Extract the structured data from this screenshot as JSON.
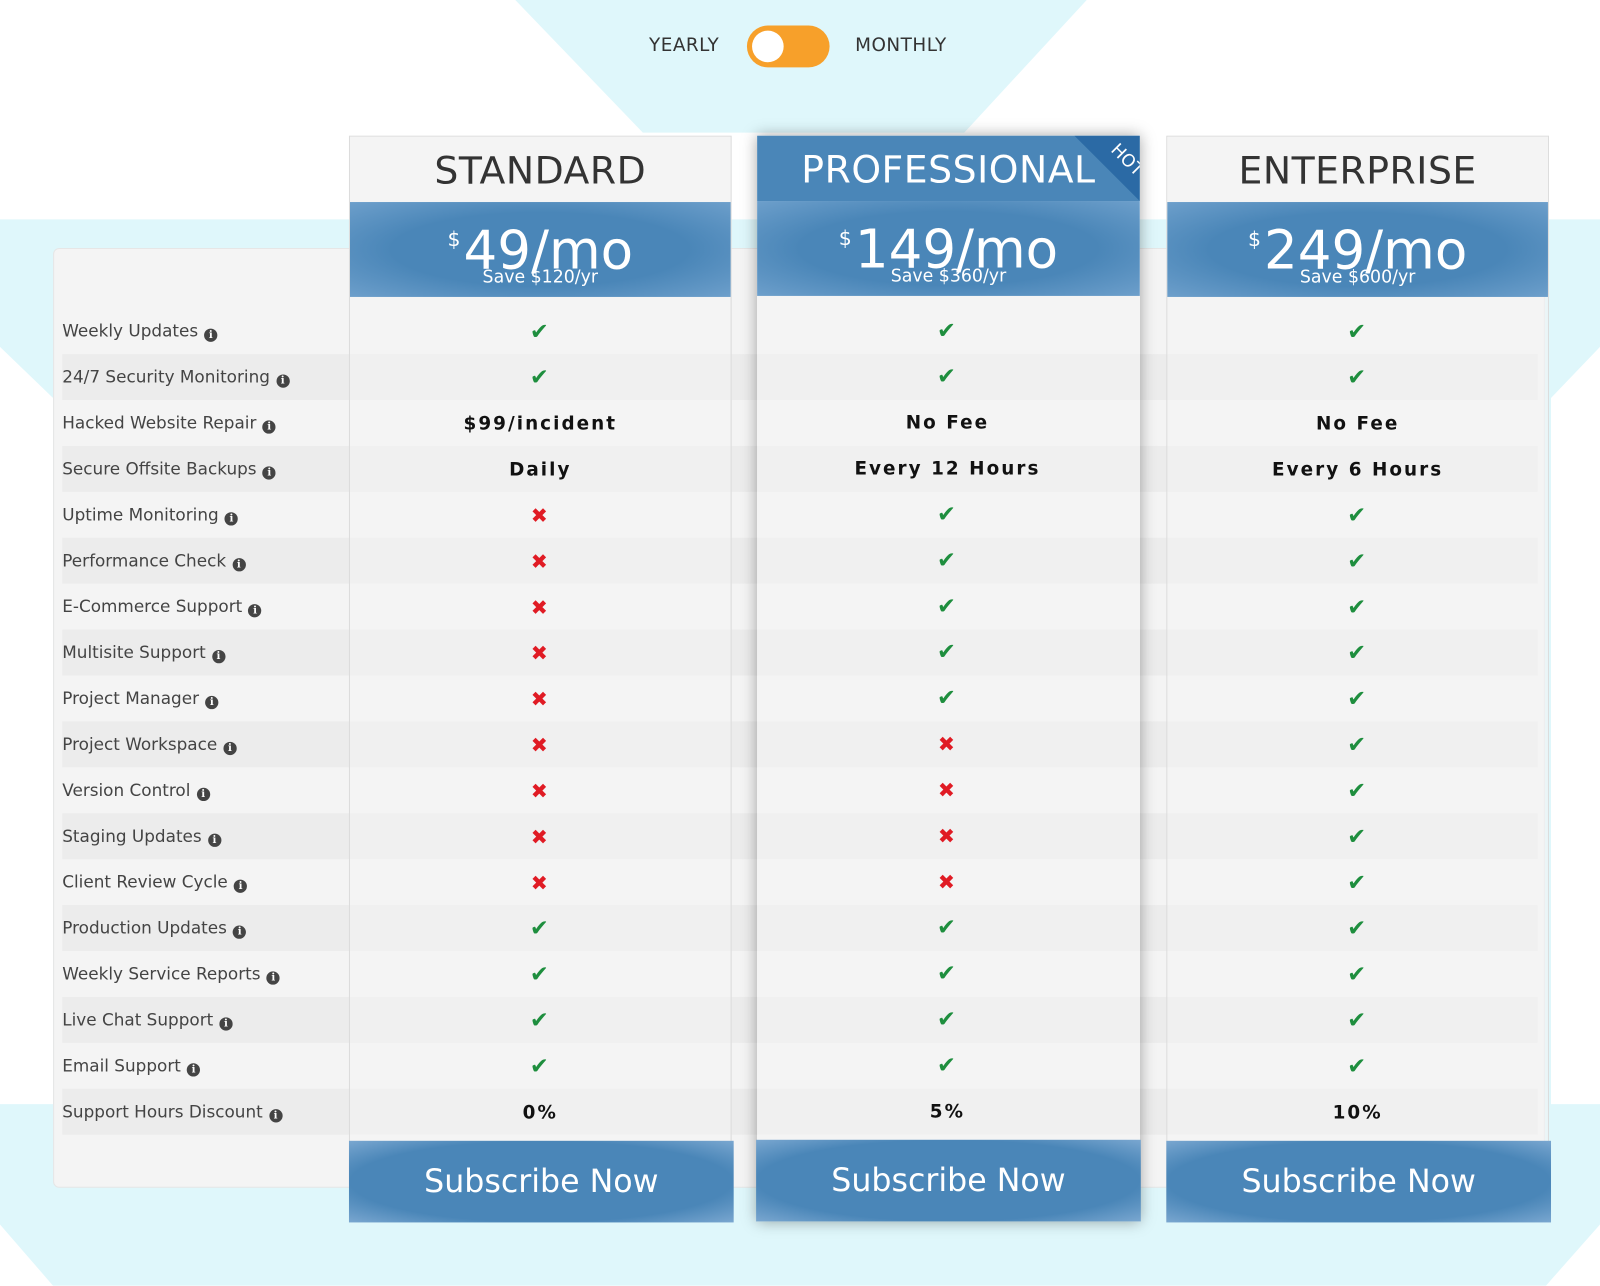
{
  "colors": {
    "accent": "#f7a02a",
    "brand_blue": "#4a86b8",
    "check": "#1e8e3e",
    "cross": "#e01b24",
    "background_cyan": "#dff7fb"
  },
  "toggle": {
    "left_label": "YEARLY",
    "right_label": "MONTHLY",
    "selected": "MONTHLY"
  },
  "plans": [
    {
      "name": "STANDARD",
      "currency": "$",
      "price": "49/mo",
      "save": "Save $120/yr",
      "button": "Subscribe Now",
      "badge": ""
    },
    {
      "name": "PROFESSIONAL",
      "currency": "$",
      "price": "149/mo",
      "save": "Save $360/yr",
      "button": "Subscribe Now",
      "badge": "HOT"
    },
    {
      "name": "ENTERPRISE",
      "currency": "$",
      "price": "249/mo",
      "save": "Save $600/yr",
      "button": "Subscribe Now",
      "badge": ""
    }
  ],
  "info_icon": "info-circle-icon",
  "features": [
    {
      "label": "Weekly Updates",
      "values": [
        "check",
        "check",
        "check"
      ]
    },
    {
      "label": "24/7 Security Monitoring",
      "values": [
        "check",
        "check",
        "check"
      ]
    },
    {
      "label": "Hacked Website Repair",
      "values": [
        "$99/incident",
        "No Fee",
        "No Fee"
      ]
    },
    {
      "label": "Secure Offsite Backups",
      "values": [
        "Daily",
        "Every 12 Hours",
        "Every 6 Hours"
      ]
    },
    {
      "label": "Uptime Monitoring",
      "values": [
        "cross",
        "check",
        "check"
      ]
    },
    {
      "label": "Performance Check",
      "values": [
        "cross",
        "check",
        "check"
      ]
    },
    {
      "label": "E-Commerce Support",
      "values": [
        "cross",
        "check",
        "check"
      ]
    },
    {
      "label": "Multisite Support",
      "values": [
        "cross",
        "check",
        "check"
      ]
    },
    {
      "label": "Project Manager",
      "values": [
        "cross",
        "check",
        "check"
      ]
    },
    {
      "label": "Project Workspace",
      "values": [
        "cross",
        "cross",
        "check"
      ]
    },
    {
      "label": "Version Control",
      "values": [
        "cross",
        "cross",
        "check"
      ]
    },
    {
      "label": "Staging Updates",
      "values": [
        "cross",
        "cross",
        "check"
      ]
    },
    {
      "label": "Client Review Cycle",
      "values": [
        "cross",
        "cross",
        "check"
      ]
    },
    {
      "label": "Production Updates",
      "values": [
        "check",
        "check",
        "check"
      ]
    },
    {
      "label": "Weekly Service Reports",
      "values": [
        "check",
        "check",
        "check"
      ]
    },
    {
      "label": "Live Chat Support",
      "values": [
        "check",
        "check",
        "check"
      ]
    },
    {
      "label": "Email Support",
      "values": [
        "check",
        "check",
        "check"
      ]
    },
    {
      "label": "Support Hours Discount",
      "values": [
        "0%",
        "5%",
        "10%"
      ]
    }
  ]
}
